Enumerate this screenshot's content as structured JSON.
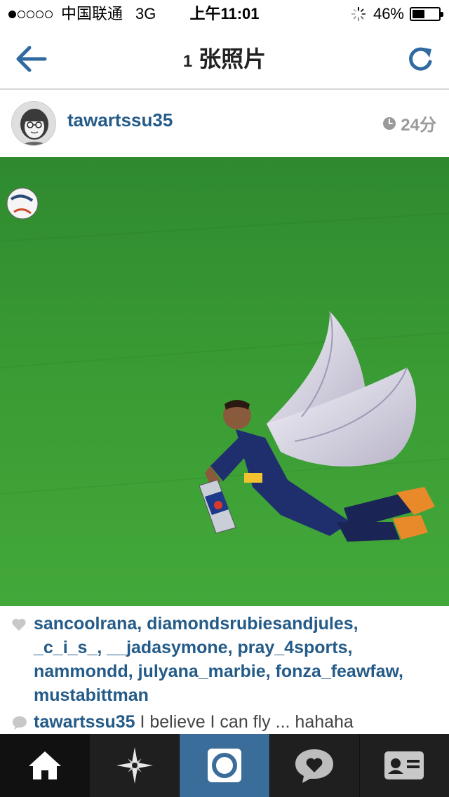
{
  "status_bar": {
    "carrier": "中国联通",
    "network": "3G",
    "time": "上午11:01",
    "battery": "46%",
    "battery_level": 0.46
  },
  "nav": {
    "title_count": "1",
    "title_text": "张照片"
  },
  "post": {
    "username": "tawartssu35",
    "time_ago": "24分",
    "likes_line1": "sancoolrana, diamondsrubiesandjules,",
    "likes_line2": "_c_i_s_, __jadasymone, pray_4sports,",
    "likes_line3": "nammondd, julyana_marbie, fonza_feawfaw,",
    "likes_line4": "mustabittman",
    "caption_user": "tawartssu35",
    "caption_text": " I believe I can fly ... hahaha"
  },
  "icons": {
    "back": "back-arrow-icon",
    "refresh": "refresh-icon",
    "clock": "clock-icon",
    "heart": "heart-icon",
    "comment": "comment-bubble-icon",
    "tabs": [
      "home-icon",
      "explore-star-icon",
      "camera-icon",
      "news-heart-bubble-icon",
      "profile-card-icon"
    ]
  },
  "colors": {
    "accent": "#245b88",
    "tab_bar": "#1f1f1f",
    "tab_active_camera": "#3b6d9a"
  }
}
